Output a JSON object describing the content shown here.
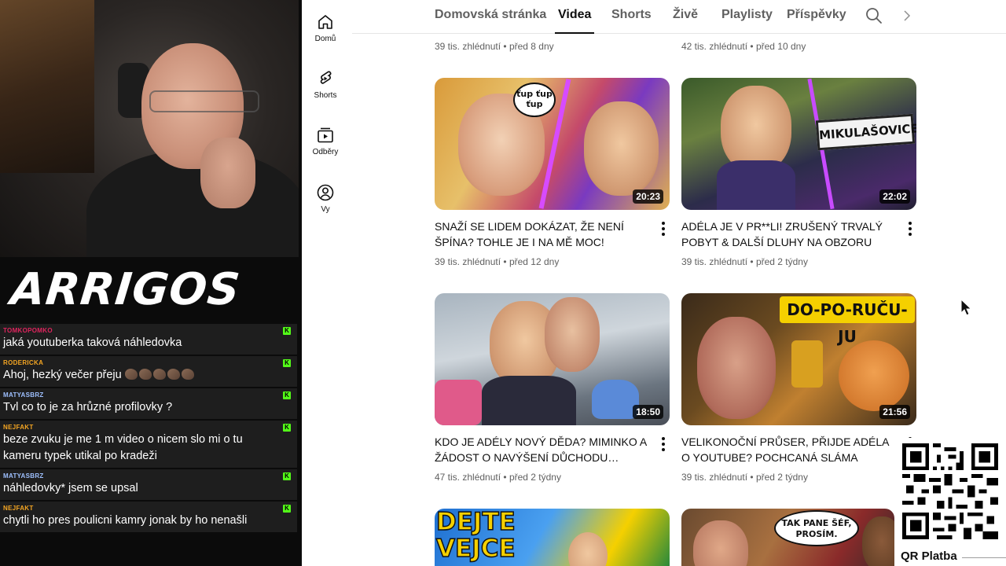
{
  "stream": {
    "logo_text": "ARRIGOS",
    "chat": [
      {
        "user": "TOMKOPOMKO",
        "user_color": "#e0245e",
        "text": "jaká youtuberka taková náhledovka",
        "emotes": 0
      },
      {
        "user": "RODERICKA",
        "user_color": "#f5a623",
        "text": "Ahoj, hezký večer přeju",
        "emotes": 5
      },
      {
        "user": "MATYASBRZ",
        "user_color": "#9ec0ff",
        "text": "Tvl co to je za hrůzné profilovky ?",
        "emotes": 0
      },
      {
        "user": "NEJFAKT",
        "user_color": "#f5a623",
        "text": "beze zvuku je me 1 m video o nicem slo mi o tu kameru typek utikal po kradeži",
        "emotes": 0
      },
      {
        "user": "MATYASBRZ",
        "user_color": "#9ec0ff",
        "text": "náhledovky* jsem se upsal",
        "emotes": 0
      },
      {
        "user": "NEJFAKT",
        "user_color": "#f5a623",
        "text": "chytli ho pres poulicni kamry jonak by ho nenašli",
        "emotes": 0
      }
    ],
    "badge_letter": "K"
  },
  "sidebar": {
    "items": [
      {
        "label": "Domů",
        "icon": "home-icon"
      },
      {
        "label": "Shorts",
        "icon": "shorts-icon"
      },
      {
        "label": "Odběry",
        "icon": "subscriptions-icon"
      },
      {
        "label": "Vy",
        "icon": "you-icon"
      }
    ]
  },
  "tabs": {
    "items": [
      "Domovská stránka",
      "Videa",
      "Shorts",
      "Živě",
      "Playlisty",
      "Příspěvky"
    ],
    "active": "Videa"
  },
  "videos": {
    "top_row_meta": [
      {
        "views": "39 tis. zhlédnutí",
        "age": "před 8 dny"
      },
      {
        "views": "42 tis. zhlédnutí",
        "age": "před 10 dny"
      }
    ],
    "items": [
      {
        "title": "SNAŽÍ SE LIDEM DOKÁZAT, ŽE NENÍ ŠPÍNA? TOHLE JE I NA MĚ MOC! #shopaholicadel…",
        "views": "39 tis. zhlédnutí",
        "age": "před 12 dny",
        "duration": "20:23",
        "thumb_text": "ťup ťup ťup"
      },
      {
        "title": "ADÉLA JE V PR**LI! ZRUŠENÝ TRVALÝ POBYT & DALŠÍ DLUHY NA OBZORU #hovo…",
        "views": "39 tis. zhlédnutí",
        "age": "před 2 týdny",
        "duration": "22:02",
        "thumb_text": "MIKULAŠOVICE"
      },
      {
        "title": "KDO JE ADÉLY NOVÝ DĚDA? MIMINKO A ŽÁDOST O NAVÝŠENÍ DŮCHODU…",
        "views": "47 tis. zhlédnutí",
        "age": "před 2 týdny",
        "duration": "18:50",
        "thumb_text": ""
      },
      {
        "title": "VELIKONOČNÍ PRŮSER, PŘIJDE ADÉLA O YOUTUBE? POCHCANÁ SLÁMA NEBO…",
        "views": "39 tis. zhlédnutí",
        "age": "před 2 týdny",
        "duration": "21:56",
        "thumb_text": "DO-PO-RUČU-JU"
      }
    ],
    "bottom_row_thumb_text": [
      "DEJTE VEJCE",
      "TAK PANE ŠÉF, PROSÍM."
    ]
  },
  "qr": {
    "label": "QR Platba"
  },
  "colors": {
    "text_primary": "#0f0f0f",
    "text_secondary": "#606060",
    "chat_bg": "#1e1e1e",
    "kick_green": "#53fc18"
  }
}
